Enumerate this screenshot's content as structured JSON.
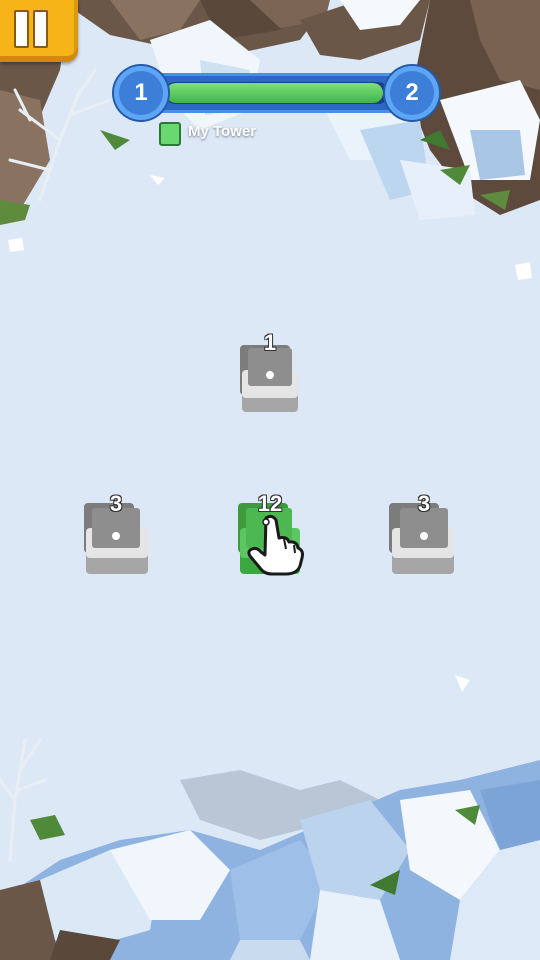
{
  "hud": {
    "pause_icon": "pause-icon",
    "team_left_count": "1",
    "team_right_count": "2",
    "progress_fill_fraction": 0.98,
    "legend_label": "My Tower"
  },
  "colors": {
    "player": "#5cc660",
    "neutral": "#9a9a9a",
    "hud_blue": "#2d68c4",
    "pause_yellow": "#f6b419"
  },
  "towers": [
    {
      "id": "top",
      "owner": "neutral",
      "count": "1"
    },
    {
      "id": "left",
      "owner": "neutral",
      "count": "3"
    },
    {
      "id": "center",
      "owner": "player",
      "count": "12"
    },
    {
      "id": "right",
      "owner": "neutral",
      "count": "3"
    }
  ],
  "tutorial": {
    "icon": "pointing-hand-icon"
  }
}
